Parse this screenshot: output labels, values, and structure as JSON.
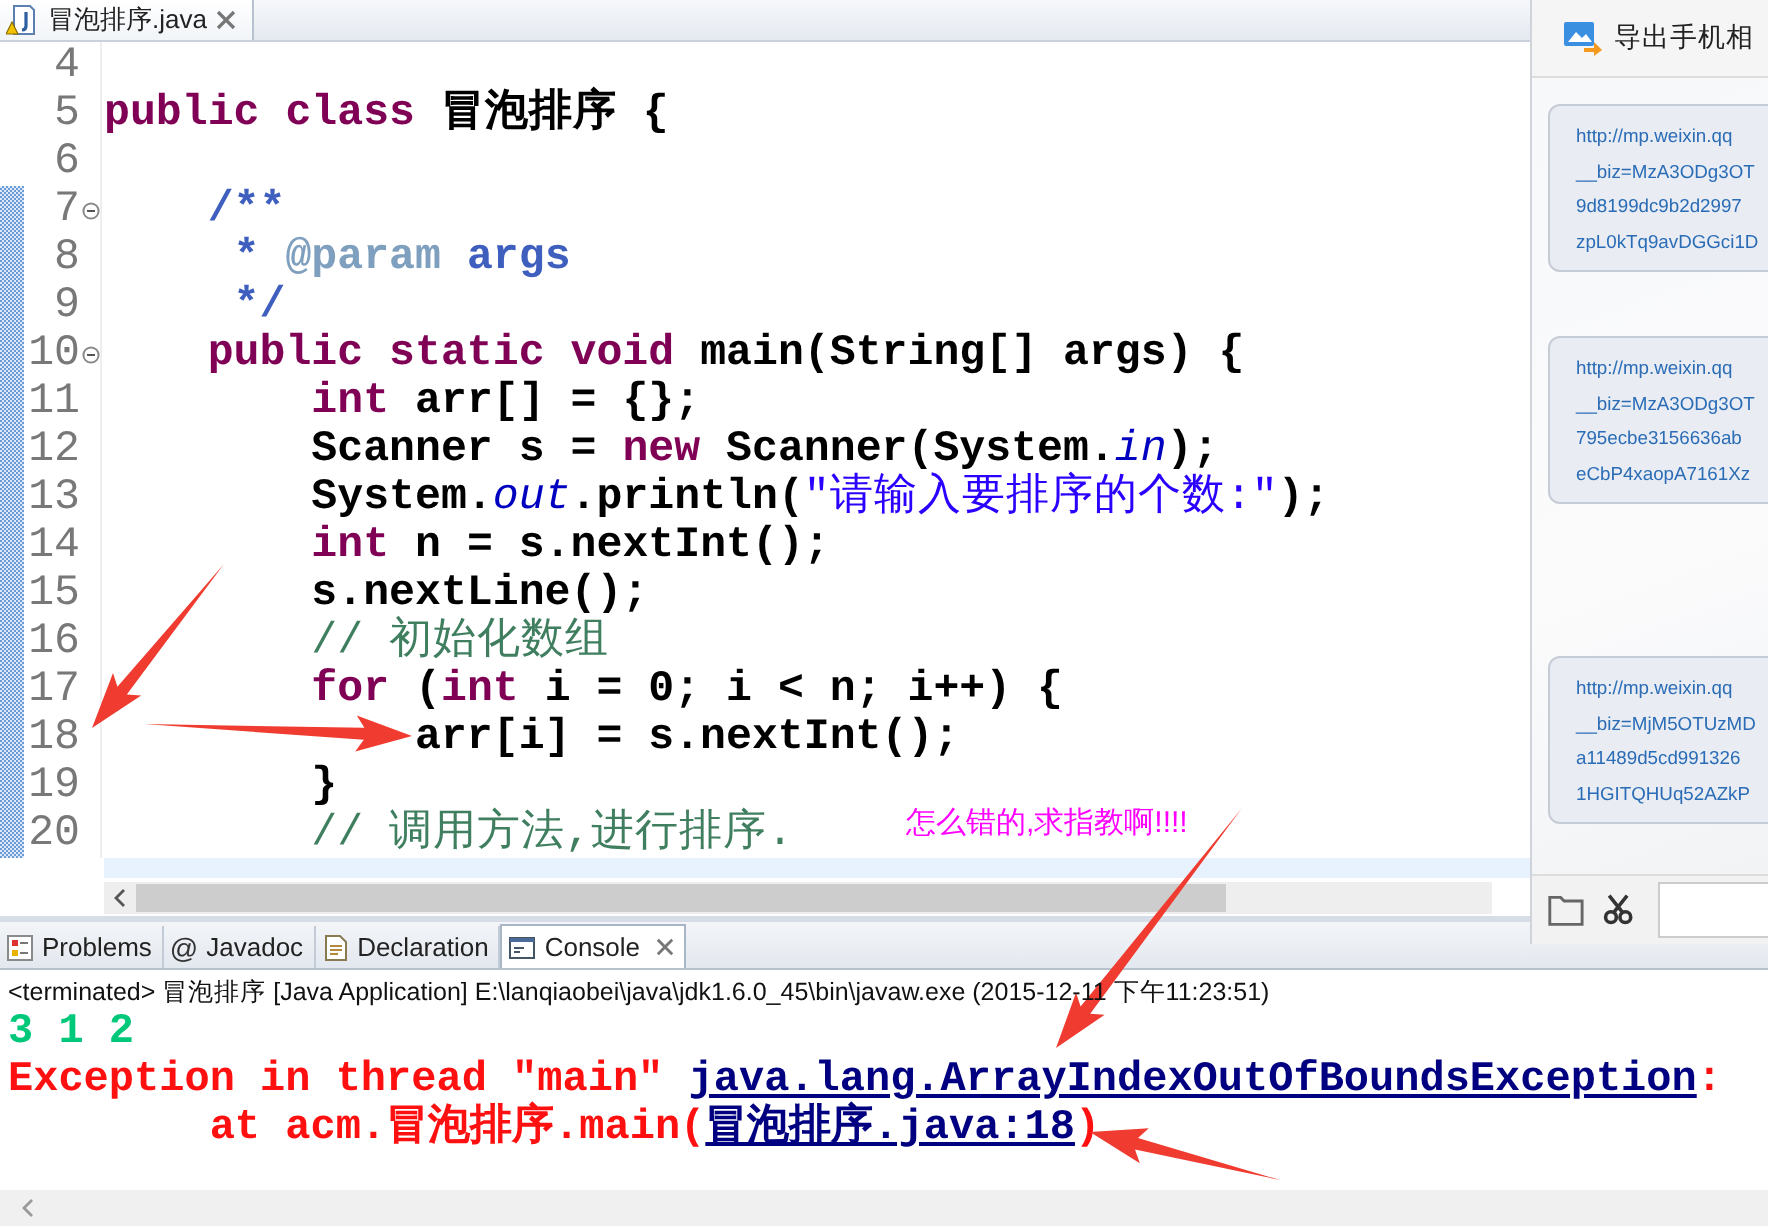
{
  "editor_tab": {
    "title": "冒泡排序.java"
  },
  "code_lines": [
    {
      "number": "4",
      "marked": false,
      "fold": false
    },
    {
      "number": "5",
      "marked": false,
      "fold": false,
      "tokens": [
        {
          "kind": "keyword",
          "text": "public class"
        },
        {
          "kind": "plain",
          "text": " 冒泡排序 {"
        }
      ]
    },
    {
      "number": "6",
      "marked": false,
      "fold": false
    },
    {
      "number": "7",
      "marked": true,
      "fold": true,
      "tokens": [
        {
          "kind": "javadoc",
          "text": "    /**"
        }
      ]
    },
    {
      "number": "8",
      "marked": true,
      "fold": false,
      "tokens": [
        {
          "kind": "javadoc",
          "text": "     * "
        },
        {
          "kind": "tag",
          "text": "@param"
        },
        {
          "kind": "javadoc",
          "text": " args"
        }
      ]
    },
    {
      "number": "9",
      "marked": true,
      "fold": false,
      "tokens": [
        {
          "kind": "javadoc",
          "text": "     */"
        }
      ]
    },
    {
      "number": "10",
      "marked": true,
      "fold": true,
      "tokens": [
        {
          "kind": "keyword",
          "text": "    public static void"
        },
        {
          "kind": "plain",
          "text": " main(String[] args) {"
        }
      ]
    },
    {
      "number": "11",
      "marked": true,
      "fold": false,
      "tokens": [
        {
          "kind": "keyword",
          "text": "        int"
        },
        {
          "kind": "plain",
          "text": " arr[] = {};"
        }
      ]
    },
    {
      "number": "12",
      "marked": true,
      "fold": false,
      "tokens": [
        {
          "kind": "plain",
          "text": "        Scanner s = "
        },
        {
          "kind": "keyword",
          "text": "new"
        },
        {
          "kind": "plain",
          "text": " Scanner(System."
        },
        {
          "kind": "field",
          "text": "in"
        },
        {
          "kind": "plain",
          "text": ");"
        }
      ]
    },
    {
      "number": "13",
      "marked": true,
      "fold": false,
      "tokens": [
        {
          "kind": "plain",
          "text": "        System."
        },
        {
          "kind": "field",
          "text": "out"
        },
        {
          "kind": "plain",
          "text": ".println("
        },
        {
          "kind": "string",
          "text": "\"请输入要排序的个数:\""
        },
        {
          "kind": "plain",
          "text": ");"
        }
      ]
    },
    {
      "number": "14",
      "marked": true,
      "fold": false,
      "tokens": [
        {
          "kind": "keyword",
          "text": "        int"
        },
        {
          "kind": "plain",
          "text": " n = s.nextInt();"
        }
      ]
    },
    {
      "number": "15",
      "marked": true,
      "fold": false,
      "tokens": [
        {
          "kind": "plain",
          "text": "        s.nextLine();"
        }
      ]
    },
    {
      "number": "16",
      "marked": true,
      "fold": false,
      "tokens": [
        {
          "kind": "comment",
          "text": "        // 初始化数组"
        }
      ]
    },
    {
      "number": "17",
      "marked": true,
      "fold": false,
      "tokens": [
        {
          "kind": "keyword",
          "text": "        for"
        },
        {
          "kind": "plain",
          "text": " ("
        },
        {
          "kind": "keyword",
          "text": "int"
        },
        {
          "kind": "plain",
          "text": " i = 0; i < n; i++) {"
        }
      ]
    },
    {
      "number": "18",
      "marked": true,
      "fold": false,
      "tokens": [
        {
          "kind": "plain",
          "text": "            arr[i] = s.nextInt();"
        }
      ]
    },
    {
      "number": "19",
      "marked": true,
      "fold": false,
      "tokens": [
        {
          "kind": "plain",
          "text": "        }"
        }
      ]
    },
    {
      "number": "20",
      "marked": true,
      "fold": false,
      "tokens": [
        {
          "kind": "comment",
          "text": "        // 调用方法,进行排序."
        }
      ]
    }
  ],
  "annotation": {
    "text": "怎么错的,求指教啊!!!!"
  },
  "chat_panel": {
    "header": "导出手机相",
    "messages": [
      {
        "lines": [
          "http://mp.weixin.qq",
          "__biz=MzA3ODg3OT",
          "9d8199dc9b2d2997",
          "zpL0kTq9avDGGci1D"
        ]
      },
      {
        "lines": [
          "http://mp.weixin.qq",
          "__biz=MzA3ODg3OT",
          "795ecbe3156636ab",
          "eCbP4xaopA7161Xz"
        ]
      },
      {
        "lines": [
          "http://mp.weixin.qq",
          "__biz=MjM5OTUzMD",
          "a11489d5cd991326",
          "1HGITQHUq52AZkP"
        ]
      }
    ]
  },
  "console": {
    "tabs": [
      {
        "kind": "problems",
        "label": "Problems",
        "selected": false
      },
      {
        "kind": "javadoc",
        "glyph": "@",
        "label": "Javadoc",
        "selected": false
      },
      {
        "kind": "declaration",
        "label": "Declaration",
        "selected": false
      },
      {
        "kind": "console",
        "label": "Console",
        "selected": true
      }
    ],
    "status": "<terminated> 冒泡排序 [Java Application] E:\\lanqiaobei\\java\\jdk1.6.0_45\\bin\\javaw.exe (2015-12-11 下午11:23:51)",
    "lines": [
      [
        {
          "kind": "input",
          "text": "3 1 2"
        }
      ],
      [
        {
          "kind": "error",
          "text": "Exception in thread \"main\" "
        },
        {
          "kind": "link",
          "text": "java.lang.ArrayIndexOutOfBoundsException"
        },
        {
          "kind": "error",
          "text": ":"
        }
      ],
      [
        {
          "kind": "error",
          "text": "        at acm.冒泡排序.main("
        },
        {
          "kind": "link",
          "text": "冒泡排序.java:18"
        },
        {
          "kind": "error",
          "text": ")"
        }
      ]
    ]
  }
}
